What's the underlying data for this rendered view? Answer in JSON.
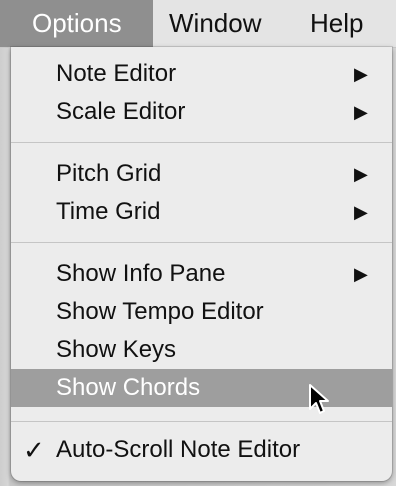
{
  "menubar": {
    "items": [
      {
        "label": "Options"
      },
      {
        "label": "Window"
      },
      {
        "label": "Help"
      }
    ]
  },
  "menu": {
    "items": [
      {
        "label": "Note Editor",
        "arrow": "▶"
      },
      {
        "label": "Scale Editor",
        "arrow": "▶"
      },
      {
        "label": "Pitch Grid",
        "arrow": "▶"
      },
      {
        "label": "Time Grid",
        "arrow": "▶"
      },
      {
        "label": "Show Info Pane",
        "arrow": "▶"
      },
      {
        "label": "Show Tempo Editor"
      },
      {
        "label": "Show Keys"
      },
      {
        "label": "Show Chords"
      },
      {
        "label": "Auto-Scroll Note Editor",
        "check": "✓"
      }
    ]
  },
  "colors": {
    "menubar_active": "#8f8f8f",
    "menu_highlight": "#9e9e9e",
    "menu_background": "#ececec"
  },
  "icons": {
    "submenu": "triangle-right-icon",
    "checkmark": "check-icon",
    "pointer": "arrow-cursor-icon"
  }
}
